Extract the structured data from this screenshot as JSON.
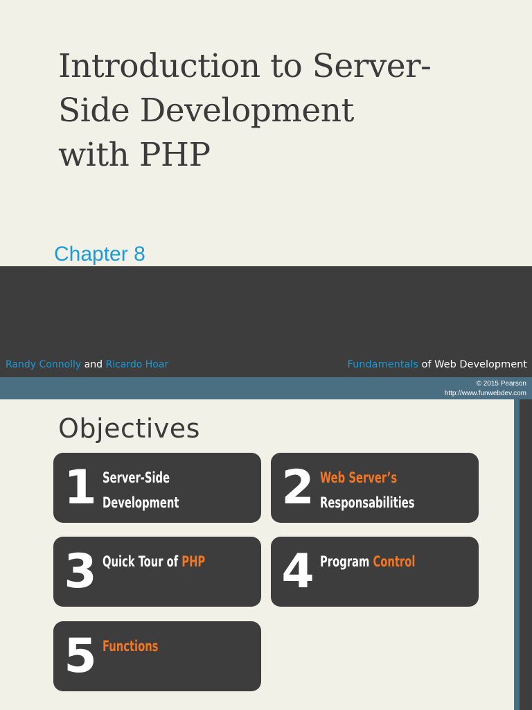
{
  "title_slide": {
    "title_lines": [
      "Introduction to Server-",
      "Side Development",
      "with PHP"
    ],
    "chapter": "Chapter 8",
    "authors": {
      "author1": "Randy Connolly",
      "and": " and ",
      "author2": "Ricardo Hoar"
    },
    "book": {
      "highlight": "Fundamentals",
      "of": " of ",
      "rest": "Web Development"
    },
    "copyright": "© 2015 Pearson",
    "url": "http://www.funwebdev.com"
  },
  "objectives_slide": {
    "heading": "Objectives",
    "items": [
      {
        "number": "1",
        "line1_plain": "Server-Side",
        "line2_plain": "Development"
      },
      {
        "number": "2",
        "line1_orange": "Web Server’s",
        "line2_plain": "Responsabilities"
      },
      {
        "number": "3",
        "prefix": "Quick Tour of ",
        "highlight": "PHP"
      },
      {
        "number": "4",
        "prefix": "Program ",
        "highlight": "Control"
      },
      {
        "number": "5",
        "highlight": "Functions"
      }
    ]
  },
  "colors": {
    "background": "#f2f1e8",
    "dark": "#3d3d3d",
    "accent_blue": "#1a9ad6",
    "band_blue": "#4a6e82",
    "accent_orange": "#f27623"
  }
}
